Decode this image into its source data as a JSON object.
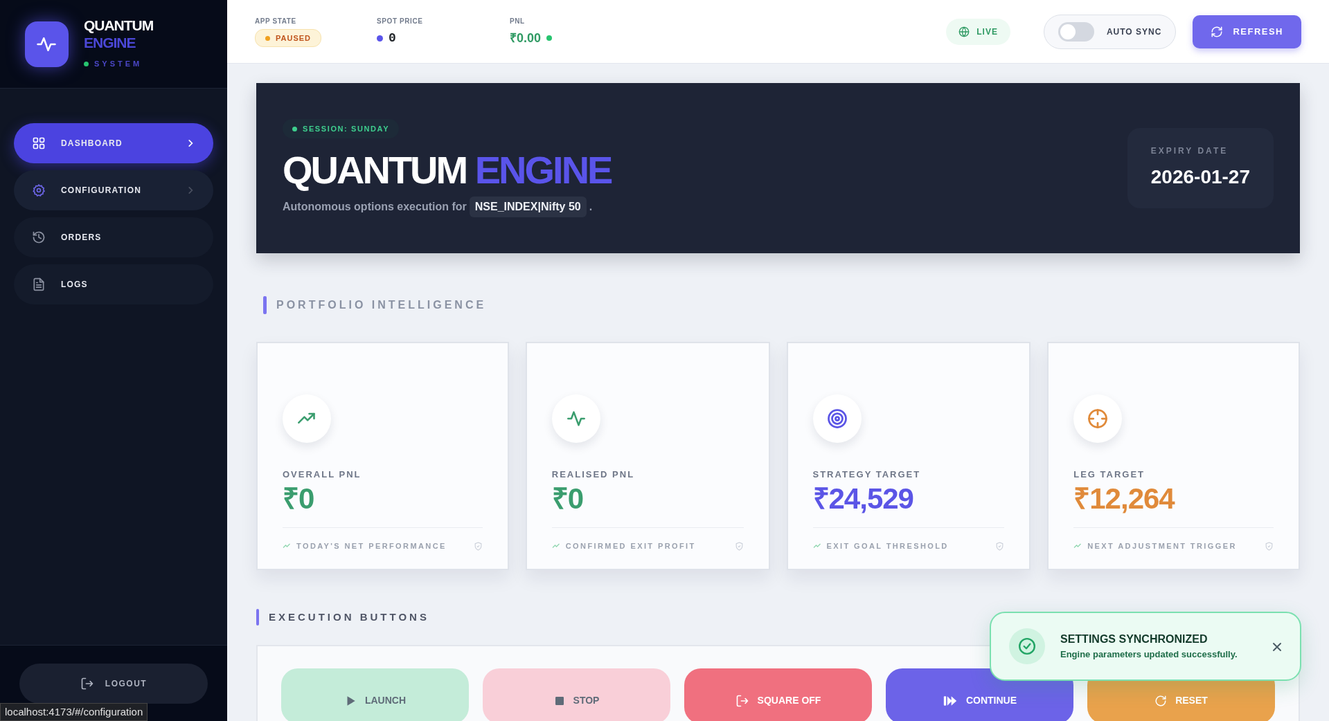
{
  "brand": {
    "word1": "QUANTUM",
    "word2": "ENGINE",
    "subtitle": "SYSTEM"
  },
  "sidebar": {
    "items": [
      {
        "label": "DASHBOARD",
        "selected": true,
        "hovered": false
      },
      {
        "label": "CONFIGURATION",
        "selected": false,
        "hovered": true
      },
      {
        "label": "ORDERS",
        "selected": false,
        "hovered": false
      },
      {
        "label": "LOGS",
        "selected": false,
        "hovered": false
      }
    ],
    "logout": "LOGOUT"
  },
  "status_url": "localhost:4173/#/configuration",
  "top_bar": {
    "app_state": {
      "label": "APP STATE",
      "value": "PAUSED"
    },
    "spot_price": {
      "label": "SPOT PRICE",
      "value": "0"
    },
    "pnl": {
      "label": "PNL",
      "value": "₹0.00"
    },
    "live": "LIVE",
    "auto_sync": {
      "label": "AUTO SYNC",
      "on": false
    },
    "refresh": "REFRESH"
  },
  "hero": {
    "session": "SESSION: SUNDAY",
    "title1": "QUANTUM",
    "title2": "ENGINE",
    "subtitle": "Autonomous options execution for",
    "instrument": "NSE_INDEX|Nifty 50",
    "period": ".",
    "expiry_label": "EXPIRY DATE",
    "expiry": "2026-01-27"
  },
  "portfolio": {
    "title": "PORTFOLIO INTELLIGENCE",
    "cards": [
      {
        "label": "OVERALL PNL",
        "value": "₹0",
        "note": "TODAY'S NET PERFORMANCE",
        "color": "#3a9d6e"
      },
      {
        "label": "REALISED PNL",
        "value": "₹0",
        "note": "CONFIRMED EXIT PROFIT",
        "color": "#3a9d6e"
      },
      {
        "label": "STRATEGY TARGET",
        "value": "₹24,529",
        "note": "EXIT GOAL THRESHOLD",
        "color": "#5b55e6"
      },
      {
        "label": "LEG TARGET",
        "value": "₹12,264",
        "note": "NEXT ADJUSTMENT TRIGGER",
        "color": "#e08a3a"
      }
    ]
  },
  "execution": {
    "title": "EXECUTION BUTTONS",
    "buttons": [
      {
        "label": "LAUNCH",
        "kind": "play",
        "color": "#c4ecd9",
        "disabled": true
      },
      {
        "label": "STOP",
        "kind": "stop",
        "color": "#f9cfd8",
        "disabled": true
      },
      {
        "label": "SQUARE OFF",
        "kind": "exit",
        "color": "#f0707f",
        "disabled": false
      },
      {
        "label": "CONTINUE",
        "kind": "forward",
        "color": "#6c63e8",
        "disabled": false
      },
      {
        "label": "RESET",
        "kind": "reset",
        "color": "#e9a24c",
        "disabled": false
      }
    ]
  },
  "toast": {
    "title": "SETTINGS SYNCHRONIZED",
    "message": "Engine parameters updated successfully."
  }
}
